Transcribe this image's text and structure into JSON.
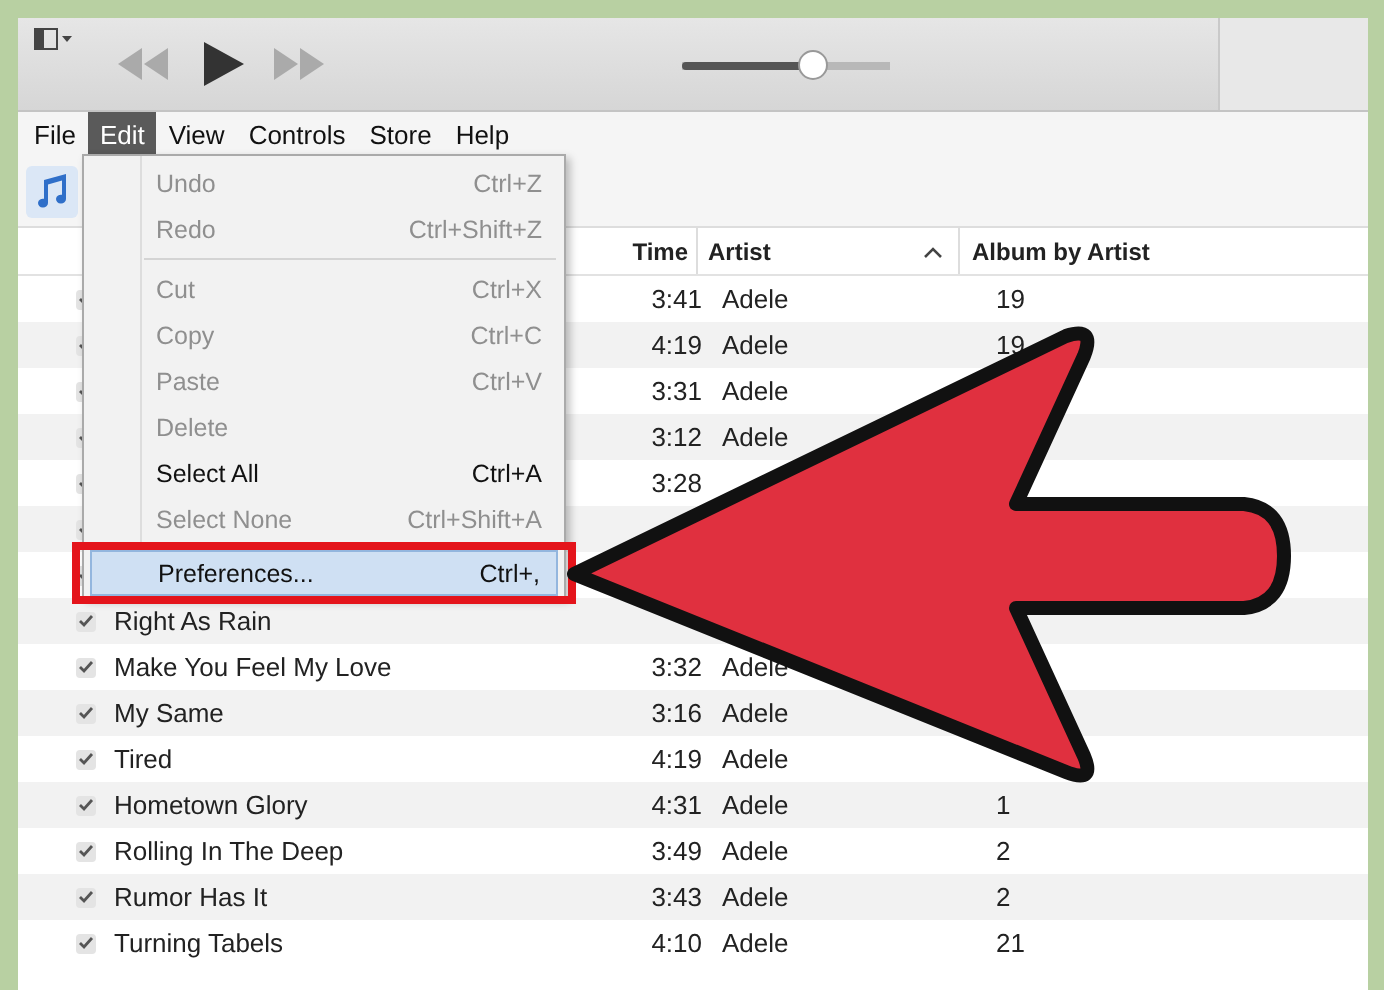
{
  "player": {
    "volume": {
      "level": 0.63
    }
  },
  "menu_bar": [
    {
      "label": "File",
      "selected": false
    },
    {
      "label": "Edit",
      "selected": true
    },
    {
      "label": "View",
      "selected": false
    },
    {
      "label": "Controls",
      "selected": false
    },
    {
      "label": "Store",
      "selected": false
    },
    {
      "label": "Help",
      "selected": false
    }
  ],
  "edit_menu": [
    {
      "kind": "item",
      "label": "Undo",
      "shortcut": "Ctrl+Z",
      "disabled": true,
      "highlighted": false,
      "callout": false
    },
    {
      "kind": "item",
      "label": "Redo",
      "shortcut": "Ctrl+Shift+Z",
      "disabled": true,
      "highlighted": false,
      "callout": false
    },
    {
      "kind": "separator"
    },
    {
      "kind": "item",
      "label": "Cut",
      "shortcut": "Ctrl+X",
      "disabled": true,
      "highlighted": false,
      "callout": false
    },
    {
      "kind": "item",
      "label": "Copy",
      "shortcut": "Ctrl+C",
      "disabled": true,
      "highlighted": false,
      "callout": false
    },
    {
      "kind": "item",
      "label": "Paste",
      "shortcut": "Ctrl+V",
      "disabled": true,
      "highlighted": false,
      "callout": false
    },
    {
      "kind": "item",
      "label": "Delete",
      "disabled": true,
      "highlighted": false,
      "callout": false
    },
    {
      "kind": "item",
      "label": "Select All",
      "shortcut": "Ctrl+A",
      "disabled": false,
      "highlighted": false,
      "callout": false
    },
    {
      "kind": "item",
      "label": "Select None",
      "shortcut": "Ctrl+Shift+A",
      "disabled": true,
      "highlighted": false,
      "callout": false
    },
    {
      "kind": "separator"
    },
    {
      "kind": "item",
      "label": "Preferences...",
      "shortcut": "Ctrl+,",
      "disabled": false,
      "highlighted": true,
      "callout": true
    }
  ],
  "table": {
    "columns": [
      {
        "label": "Time",
        "sorted": false
      },
      {
        "label": "Artist",
        "sorted": true
      },
      {
        "label": "Album by Artist",
        "sorted": false
      }
    ],
    "rows": [
      {
        "checked": true,
        "time": "3:41",
        "artist": "Adele",
        "album": "19"
      },
      {
        "checked": true,
        "time": "4:19",
        "artist": "Adele",
        "album": "19"
      },
      {
        "checked": true,
        "time": "3:31",
        "artist": "Adele"
      },
      {
        "checked": true,
        "time": "3:12",
        "artist": "Adele"
      },
      {
        "checked": true,
        "time": "3:28"
      },
      {
        "checked": true
      },
      {
        "checked": true
      },
      {
        "checked": true,
        "title": "Right As Rain"
      },
      {
        "checked": true,
        "title": "Make You Feel My Love",
        "time": "3:32",
        "artist": "Adele"
      },
      {
        "checked": true,
        "title": "My Same",
        "time": "3:16",
        "artist": "Adele"
      },
      {
        "checked": true,
        "title": "Tired",
        "time": "4:19",
        "artist": "Adele"
      },
      {
        "checked": true,
        "title": "Hometown Glory",
        "time": "4:31",
        "artist": "Adele",
        "album": "1"
      },
      {
        "checked": true,
        "title": "Rolling In The Deep",
        "time": "3:49",
        "artist": "Adele",
        "album": "2"
      },
      {
        "checked": true,
        "title": "Rumor Has It",
        "time": "3:43",
        "artist": "Adele",
        "album": "2"
      },
      {
        "checked": true,
        "title": "Turning Tabels",
        "time": "4:10",
        "artist": "Adele",
        "album": "21"
      }
    ]
  }
}
